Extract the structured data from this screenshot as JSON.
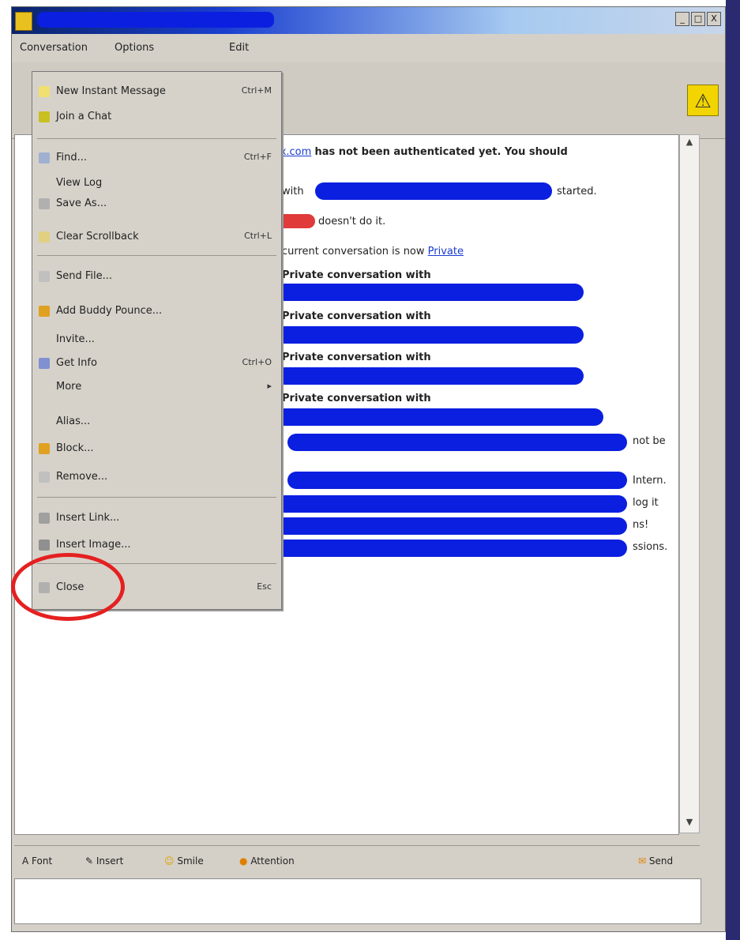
{
  "window": {
    "min": "_",
    "max": "□",
    "close": "X"
  },
  "menubar": {
    "items": [
      "Conversation",
      "Options",
      "Edit"
    ]
  },
  "dropdown": {
    "items": [
      {
        "label": "New Instant Message",
        "shortcut": "Ctrl+M",
        "icon": "message-icon"
      },
      {
        "label": "Join a Chat",
        "shortcut": "",
        "icon": "chat-icon"
      },
      {
        "label": "Find...",
        "shortcut": "Ctrl+F",
        "icon": "find-icon"
      },
      {
        "label": "View Log",
        "shortcut": "",
        "icon": ""
      },
      {
        "label": "Save As...",
        "shortcut": "",
        "icon": "save-icon"
      },
      {
        "label": "Clear Scrollback",
        "shortcut": "Ctrl+L",
        "icon": "clear-icon"
      },
      {
        "label": "Send File...",
        "shortcut": "",
        "icon": "file-icon"
      },
      {
        "label": "Add Buddy Pounce...",
        "shortcut": "",
        "icon": "pounce-icon"
      },
      {
        "label": "Get Info",
        "shortcut": "Ctrl+O",
        "icon": "info-icon"
      },
      {
        "label": "Invite...",
        "shortcut": "",
        "icon": ""
      },
      {
        "label": "More",
        "shortcut": "▸",
        "icon": ""
      },
      {
        "label": "Alias...",
        "shortcut": "",
        "icon": ""
      },
      {
        "label": "Block...",
        "shortcut": "",
        "icon": "block-icon"
      },
      {
        "label": "Remove...",
        "shortcut": "",
        "icon": "remove-icon"
      },
      {
        "label": "Insert Link...",
        "shortcut": "",
        "icon": "link-icon"
      },
      {
        "label": "Insert Image...",
        "shortcut": "",
        "icon": "image-icon"
      },
      {
        "label": "Close",
        "shortcut": "Esc",
        "icon": "close-icon"
      }
    ]
  },
  "conversation": {
    "line1_link": "xx.com",
    "line1_rest": "has not been authenticated yet.  You should",
    "line2_pre": "with",
    "line2_post": "started.",
    "line3": "doesn't do it.",
    "line4_pre": "current conversation is now",
    "line4_link": "Private",
    "line5": "Private conversation with",
    "line6": "Private conversation with",
    "line7": "Private conversation with",
    "line8": "Private conversation with",
    "tail1": "not be",
    "tail2": "Intern.",
    "tail3": "log it",
    "tail4": "ns!",
    "tail5": "ssions."
  },
  "bottombar": {
    "font": "Font",
    "insert": "Insert",
    "smile": "Smile",
    "attention": "Attention",
    "send": "Send"
  }
}
